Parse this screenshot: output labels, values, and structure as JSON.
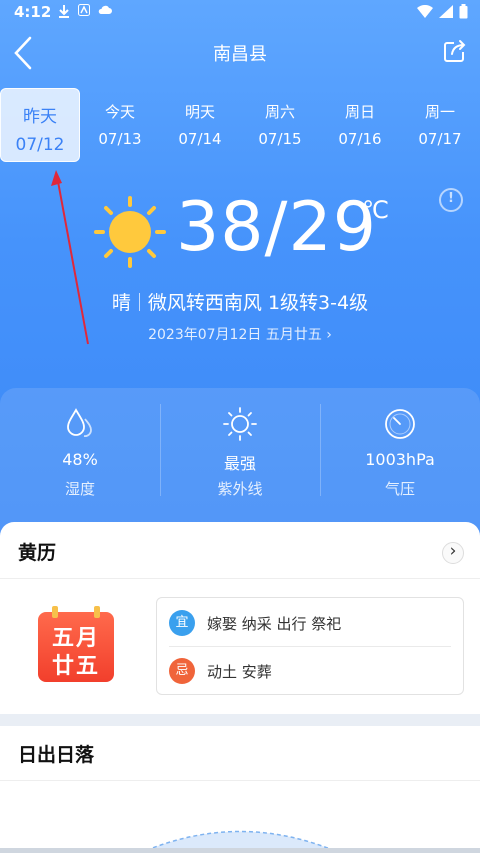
{
  "status_bar": {
    "time": "4:12"
  },
  "nav": {
    "title": "南昌县"
  },
  "tabs": [
    {
      "name": "昨天",
      "date": "07/12"
    },
    {
      "name": "今天",
      "date": "07/13"
    },
    {
      "name": "明天",
      "date": "07/14"
    },
    {
      "name": "周六",
      "date": "07/15"
    },
    {
      "name": "周日",
      "date": "07/16"
    },
    {
      "name": "周一",
      "date": "07/17"
    }
  ],
  "weather": {
    "temp_range": "38/29",
    "unit": "℃",
    "condition": "晴",
    "wind": "微风转西南风 1级转3-4级",
    "date": "2023年07月12日 五月廿五 ›"
  },
  "metrics": [
    {
      "value": "48%",
      "label": "湿度",
      "icon": "humidity-icon"
    },
    {
      "value": "最强",
      "label": "紫外线",
      "icon": "uv-sun-icon"
    },
    {
      "value": "1003hPa",
      "label": "气压",
      "icon": "pressure-gauge-icon"
    }
  ],
  "almanac": {
    "title": "黄历",
    "calendar_line1": "五月",
    "calendar_line2": "廿五",
    "yi_badge": "宜",
    "yi_text": "嫁娶 纳采 出行 祭祀",
    "ji_badge": "忌",
    "ji_text": "动土 安葬"
  },
  "sunrise": {
    "title": "日出日落"
  },
  "colors": {
    "accent_blue": "#3b88f7",
    "yi_badge": "#3aa0ee",
    "ji_badge": "#f0643a",
    "sun": "#ffc93d"
  }
}
